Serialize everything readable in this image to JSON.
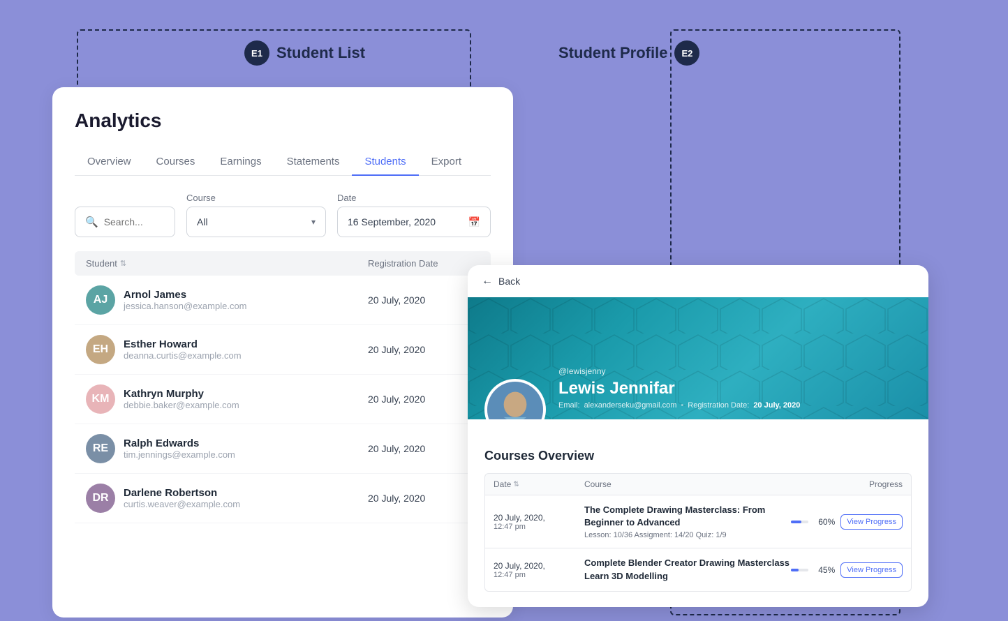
{
  "labels": {
    "e1": "E1",
    "e1_title": "Student List",
    "e2": "E2",
    "e2_title": "Student Profile"
  },
  "analytics_card": {
    "title": "Analytics",
    "tabs": [
      {
        "id": "overview",
        "label": "Overview",
        "active": false
      },
      {
        "id": "courses",
        "label": "Courses",
        "active": false
      },
      {
        "id": "earnings",
        "label": "Earnings",
        "active": false
      },
      {
        "id": "statements",
        "label": "Statements",
        "active": false
      },
      {
        "id": "students",
        "label": "Students",
        "active": true
      },
      {
        "id": "export",
        "label": "Export",
        "active": false
      }
    ],
    "search": {
      "placeholder": "Search..."
    },
    "course_filter": {
      "label": "Course",
      "value": "All"
    },
    "date_filter": {
      "label": "Date",
      "value": "16  September, 2020"
    },
    "table": {
      "col_student": "Student",
      "col_date": "Registration Date",
      "rows": [
        {
          "name": "Arnol James",
          "email": "jessica.hanson@example.com",
          "date": "20 July, 2020",
          "avatar_color": "#5ba4a4",
          "initials": "AJ"
        },
        {
          "name": "Esther Howard",
          "email": "deanna.curtis@example.com",
          "date": "20 July, 2020",
          "avatar_color": "#c4a882",
          "initials": "EH"
        },
        {
          "name": "Kathryn Murphy",
          "email": "debbie.baker@example.com",
          "date": "20 July, 2020",
          "avatar_color": "#e8b4b8",
          "initials": "KM"
        },
        {
          "name": "Ralph Edwards",
          "email": "tim.jennings@example.com",
          "date": "20 July, 2020",
          "avatar_color": "#7a8fa6",
          "initials": "RE"
        },
        {
          "name": "Darlene Robertson",
          "email": "curtis.weaver@example.com",
          "date": "20 July, 2020",
          "avatar_color": "#9b7fa6",
          "initials": "DR"
        }
      ]
    }
  },
  "profile_card": {
    "back_label": "Back",
    "username": "@lewisjenny",
    "name": "Lewis Jennifar",
    "email_label": "Email:",
    "email": "alexanderseku@gmail.com",
    "reg_date_label": "Registration Date:",
    "reg_date": "20 July, 2020",
    "courses_overview_title": "Courses Overview",
    "courses_table": {
      "col_date": "Date",
      "col_course": "Course",
      "col_progress": "Progress",
      "rows": [
        {
          "date": "20 July, 2020,",
          "time": "12:47 pm",
          "course_name": "The Complete Drawing Masterclass: From Beginner to Advanced",
          "sub": "Lesson: 10/36    Assigment: 14/20    Quiz: 1/9",
          "progress": 60,
          "view_btn": "View Progress"
        },
        {
          "date": "20 July, 2020,",
          "time": "12:47 pm",
          "course_name": "Complete Blender Creator Drawing Masterclass Learn 3D Modelling",
          "sub": "",
          "progress": 45,
          "view_btn": "View Progress"
        }
      ]
    }
  }
}
